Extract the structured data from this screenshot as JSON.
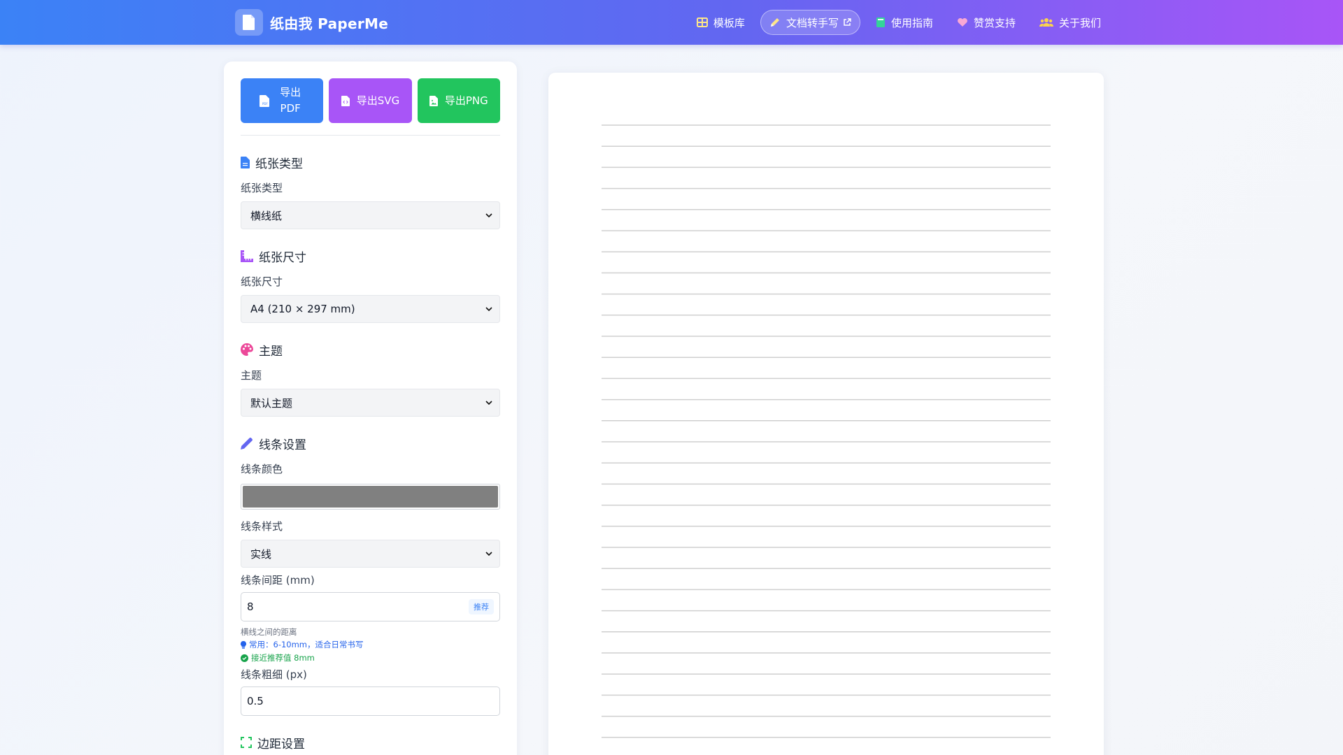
{
  "header": {
    "brand_name": "纸由我 PaperMe",
    "nav": [
      {
        "label": "模板库",
        "icon": "table-icon",
        "color": "#fde68a"
      },
      {
        "label": "文档转手写",
        "icon": "pen-icon",
        "active": true
      },
      {
        "label": "使用指南",
        "icon": "book-icon",
        "color": "#34d399"
      },
      {
        "label": "赞赏支持",
        "icon": "heart-icon",
        "color": "#f9a8d4"
      },
      {
        "label": "关于我们",
        "icon": "users-icon",
        "color": "#fcd34d"
      }
    ]
  },
  "panel": {
    "export": {
      "pdf_label": "导出PDF",
      "svg_label": "导出SVG",
      "png_label": "导出PNG"
    },
    "paper_type": {
      "section_title": "纸张类型",
      "label": "纸张类型",
      "value": "横线纸"
    },
    "paper_size": {
      "section_title": "纸张尺寸",
      "label": "纸张尺寸",
      "value": "A4 (210 × 297 mm)"
    },
    "theme": {
      "section_title": "主题",
      "label": "主题",
      "value": "默认主题"
    },
    "line": {
      "section_title": "线条设置",
      "color_label": "线条颜色",
      "color_value": "#808080",
      "style_label": "线条样式",
      "style_value": "实线",
      "spacing_label": "线条间距 (mm)",
      "spacing_value": "8",
      "recommend_badge": "推荐",
      "spacing_hint": "横线之间的距离",
      "spacing_tip": "常用：6-10mm，适合日常书写",
      "spacing_ok": "接近推荐值 8mm",
      "width_label": "线条粗细 (px)",
      "width_value": "0.5"
    },
    "margin": {
      "section_title": "边距设置"
    }
  },
  "preview": {
    "line_color": "#cfcfcf"
  }
}
